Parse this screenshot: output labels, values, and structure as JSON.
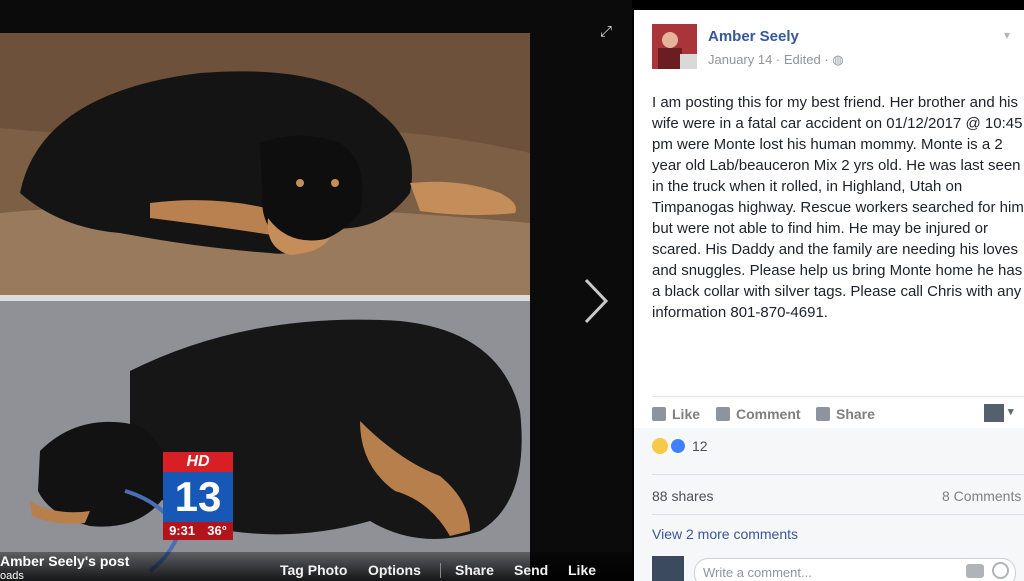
{
  "viewer": {
    "caption_title": "Amber Seely's post",
    "caption_sub": "oads",
    "actions": [
      "Tag Photo",
      "Options",
      "Share",
      "Send",
      "Like"
    ],
    "expand_icon": "expand-icon",
    "next_icon": "chevron-right-icon"
  },
  "badge": {
    "hd": "HD",
    "channel": "13",
    "time": "9:31",
    "temp": "36°"
  },
  "post": {
    "author": "Amber Seely",
    "date": "January 14 · Edited ·",
    "text": "I am posting this for my best friend. Her brother and his wife were in a fatal car accident on 01/12/2017 @ 10:45 pm were Monte lost his human mommy. Monte is a 2 year old Lab/beauceron Mix 2 yrs old. He was last seen in the truck when it rolled, in Highland, Utah on Timpanogas highway. Rescue workers searched for him but were not able to find him. He may be injured or scared. His Daddy and the family are needing his loves and snuggles. Please help us bring Monte home he has a black collar with silver tags. Please call Chris with any information 801-870-4691.",
    "like_label": "Like",
    "comment_label": "Comment",
    "share_label": "Share",
    "reaction_count": "12",
    "shares": "88 shares",
    "comments": "8 Comments",
    "view_more": "View 2 more comments",
    "comment_placeholder": "Write a comment..."
  },
  "colors": {
    "link": "#365899",
    "badge_red": "#d81f26",
    "badge_blue": "#1757b5"
  }
}
